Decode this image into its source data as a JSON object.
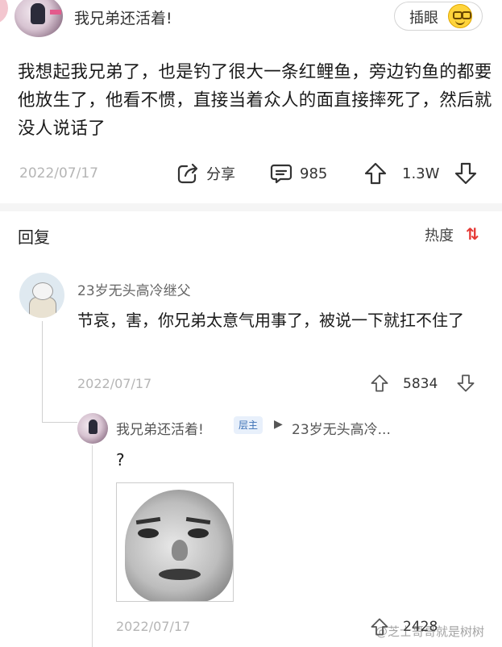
{
  "post": {
    "username": "我兄弟还活着!",
    "insert_label": "插眼",
    "text": "我想起我兄弟了，也是钓了很大一条红鲤鱼，旁边钓鱼的都要他放生了，他看不惯，直接当着众人的面直接摔死了，然后就没人说话了",
    "date": "2022/07/17",
    "share_label": "分享",
    "comment_count": "985",
    "upvote_count": "1.3W"
  },
  "replies_section": {
    "title": "回复",
    "sort_label": "热度"
  },
  "comment1": {
    "username": "23岁无头高冷继父",
    "text": "节哀，害，你兄弟太意气用事了，被说一下就扛不住了",
    "date": "2022/07/17",
    "upvote_count": "5834"
  },
  "reply1": {
    "username": "我兄弟还活着!",
    "badge": "层主",
    "reply_to": "23岁无头高冷...",
    "text": "?",
    "date": "2022/07/17",
    "upvote_count": "2428"
  },
  "watermark": "@芝士哥哥就是树树",
  "colors": {
    "accent_red": "#e53935",
    "badge_bg": "#e8f0fb",
    "badge_text": "#3a6fb5",
    "muted": "#b5b5b5"
  }
}
